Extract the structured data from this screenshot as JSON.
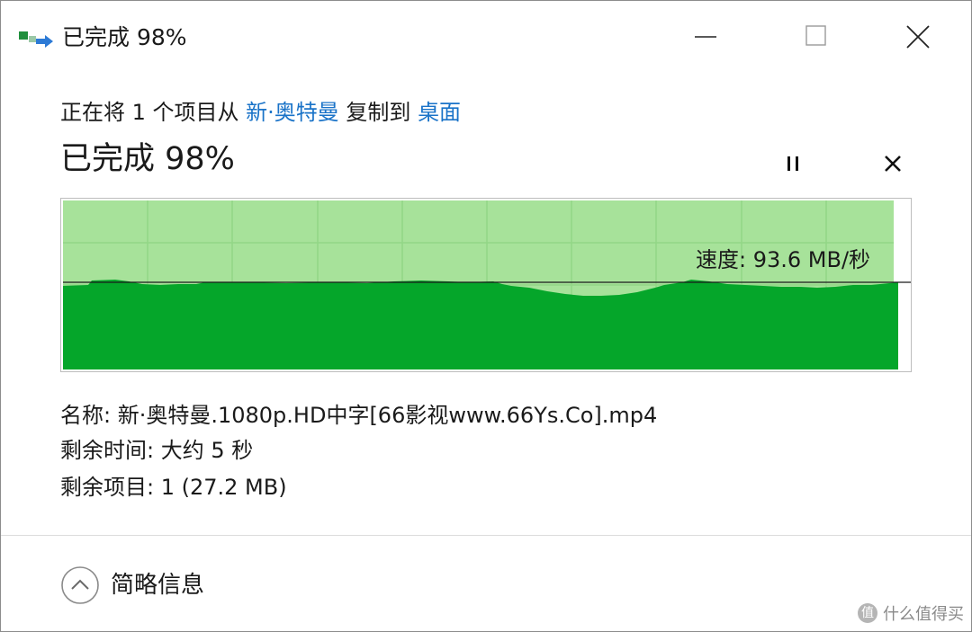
{
  "window": {
    "title": "已完成 98%",
    "icon": "copy-transfer-icon"
  },
  "controls": {
    "minimize_icon": "minimize-icon",
    "maximize_icon": "maximize-icon",
    "close_icon": "close-icon"
  },
  "operation": {
    "prefix": "正在将 1 个项目从 ",
    "source": "新·奥特曼",
    "middle": " 复制到 ",
    "destination": "桌面"
  },
  "progress": {
    "label": "已完成 98%",
    "percent": 98,
    "pause_icon": "pause-icon",
    "cancel_icon": "cancel-icon"
  },
  "speed_graph": {
    "speed_text": "速度: 93.6 MB/秒",
    "colors": {
      "filled": "#05a62a",
      "progress_bg": "#a7e29a",
      "grid": "#92d686",
      "border": "#bdbdbd"
    }
  },
  "details": {
    "name_label": "名称: ",
    "name_value": "新·奥特曼.1080p.HD中字[66影视www.66Ys.Co].mp4",
    "time_label": "剩余时间: ",
    "time_value": "大约 5 秒",
    "items_label": "剩余项目: ",
    "items_value": "1 (27.2 MB)"
  },
  "footer": {
    "toggle_label": "简略信息",
    "toggle_icon": "chevron-up-icon"
  },
  "watermark": {
    "icon_glyph": "值",
    "text": "什么值得买"
  }
}
